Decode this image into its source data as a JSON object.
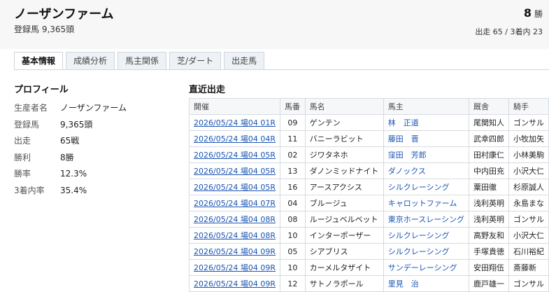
{
  "header": {
    "title": "ノーザンファーム",
    "subtitle": "登録馬 9,365頭",
    "wins_value": "8",
    "wins_unit": "勝",
    "stats": "出走 65 / 3着内 23"
  },
  "tabs": [
    "基本情報",
    "成績分析",
    "馬主関係",
    "芝/ダート",
    "出走馬"
  ],
  "profile": {
    "title": "プロフィール",
    "rows": [
      {
        "label": "生産者名",
        "value": "ノーザンファーム"
      },
      {
        "label": "登録馬",
        "value": "9,365頭"
      },
      {
        "label": "出走",
        "value": "65戦"
      },
      {
        "label": "勝利",
        "value": "8勝"
      },
      {
        "label": "勝率",
        "value": "12.3%"
      },
      {
        "label": "3着内率",
        "value": "35.4%"
      }
    ]
  },
  "recent": {
    "title": "直近出走",
    "headers": [
      "開催",
      "馬番",
      "馬名",
      "馬主",
      "厩舎",
      "騎手"
    ],
    "rows": [
      {
        "race": "2026/05/24 場04 01R",
        "no": "09",
        "horse": "ゲンテン",
        "owner": "林　正道",
        "stable": "尾関知人",
        "jockey": "ゴンサル"
      },
      {
        "race": "2026/05/24 場04 04R",
        "no": "11",
        "horse": "バニーラビット",
        "owner": "藤田　晋",
        "stable": "武幸四郎",
        "jockey": "小牧加矢"
      },
      {
        "race": "2026/05/24 場04 05R",
        "no": "02",
        "horse": "ジワタネホ",
        "owner": "窪田　芳郎",
        "stable": "田村康仁",
        "jockey": "小林美駒"
      },
      {
        "race": "2026/05/24 場04 05R",
        "no": "13",
        "horse": "ダノンミッドナイト",
        "owner": "ダノックス",
        "stable": "中内田充",
        "jockey": "小沢大仁"
      },
      {
        "race": "2026/05/24 場04 05R",
        "no": "16",
        "horse": "アースアクシス",
        "owner": "シルクレーシング",
        "stable": "粟田徹",
        "jockey": "杉原誠人"
      },
      {
        "race": "2026/05/24 場04 07R",
        "no": "04",
        "horse": "ブルージュ",
        "owner": "キャロットファーム",
        "stable": "浅利英明",
        "jockey": "永島まな"
      },
      {
        "race": "2026/05/24 場04 08R",
        "no": "08",
        "horse": "ルージュベルベット",
        "owner": "東京ホースレーシング",
        "stable": "浅利英明",
        "jockey": "ゴンサル"
      },
      {
        "race": "2026/05/24 場04 08R",
        "no": "10",
        "horse": "インターポーザー",
        "owner": "シルクレーシング",
        "stable": "高野友和",
        "jockey": "小沢大仁"
      },
      {
        "race": "2026/05/24 場04 09R",
        "no": "05",
        "horse": "シアブリス",
        "owner": "シルクレーシング",
        "stable": "手塚貴徳",
        "jockey": "石川裕紀"
      },
      {
        "race": "2026/05/24 場04 09R",
        "no": "10",
        "horse": "カーメルタザイト",
        "owner": "サンデーレーシング",
        "stable": "安田翔伍",
        "jockey": "斎藤新"
      },
      {
        "race": "2026/05/24 場04 09R",
        "no": "12",
        "horse": "サトノラポール",
        "owner": "里見　治",
        "stable": "鹿戸雄一",
        "jockey": "ゴンサル"
      }
    ]
  }
}
